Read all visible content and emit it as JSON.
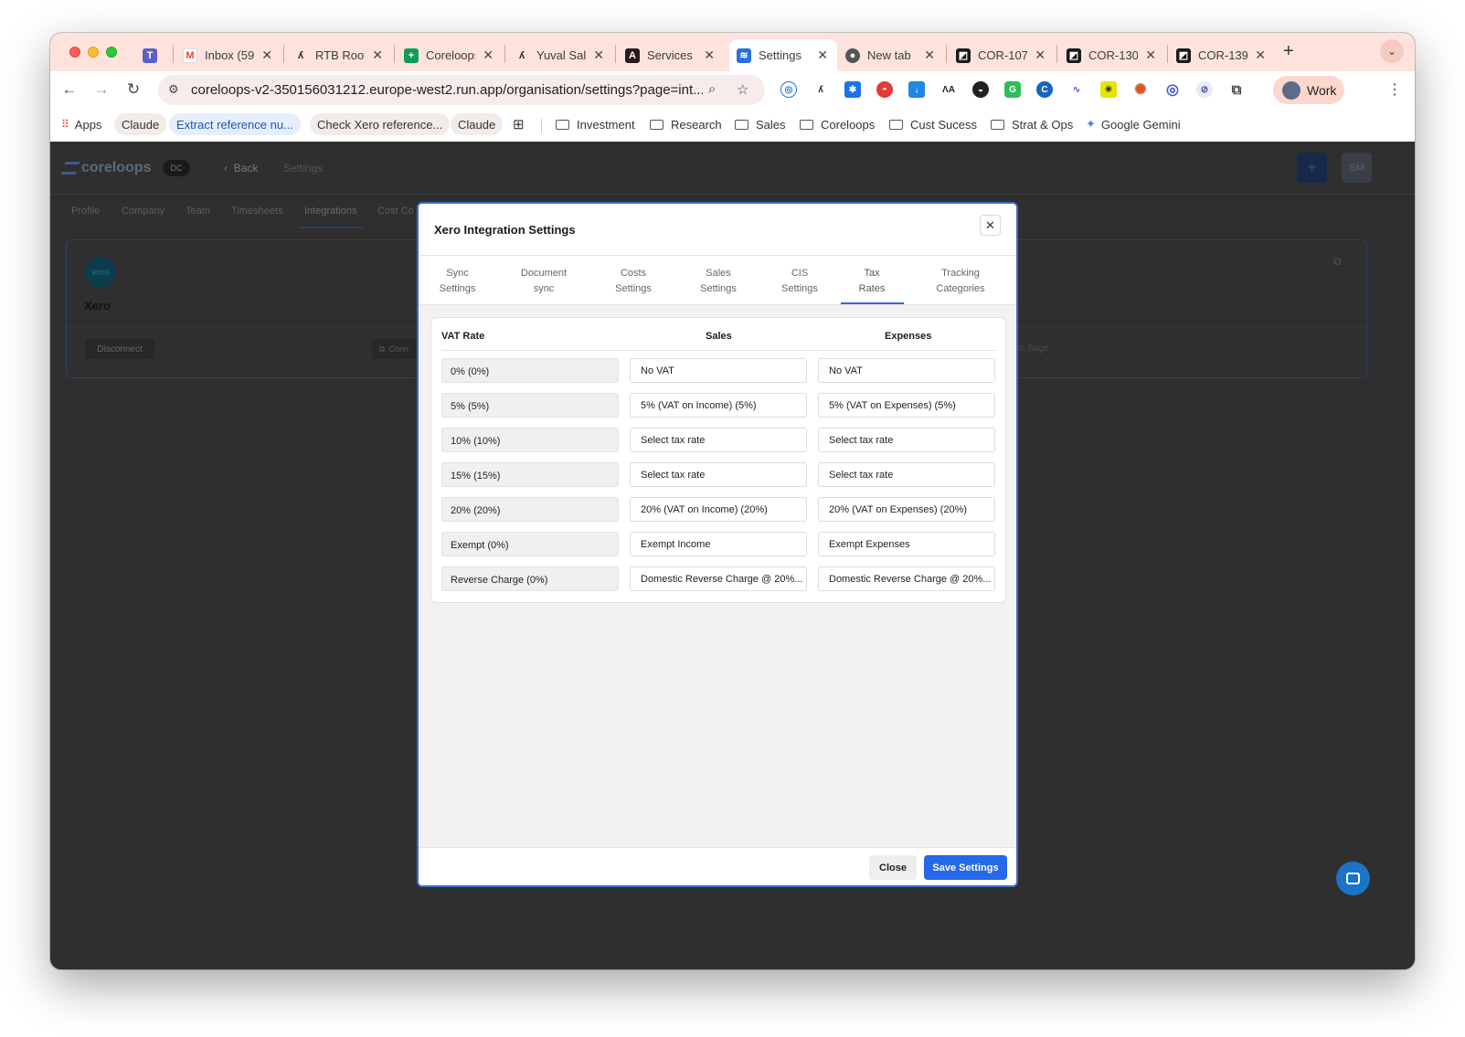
{
  "browser": {
    "tabs": [
      {
        "label": "",
        "icon": "teams-icon",
        "color": "#5b5fc7"
      },
      {
        "label": "Inbox (59",
        "icon": "gmail-icon",
        "color": "#ea4335"
      },
      {
        "label": "RTB Roof",
        "icon": "rtb-icon",
        "color": "#222222"
      },
      {
        "label": "Coreloops",
        "icon": "sheets-icon",
        "color": "#0f9d58"
      },
      {
        "label": "Yuval Sal",
        "icon": "rtb-icon",
        "color": "#222222"
      },
      {
        "label": "Services",
        "icon": "anthropic-icon",
        "color": "#2a1a1a"
      },
      {
        "label": "Settings",
        "icon": "coreloops-icon",
        "color": "#2b6fd6"
      },
      {
        "label": "New tab",
        "icon": "chrome-icon",
        "color": "#555555"
      },
      {
        "label": "COR-107",
        "icon": "linear-icon",
        "color": "#1a1a1a"
      },
      {
        "label": "COR-130",
        "icon": "linear-icon",
        "color": "#1a1a1a"
      },
      {
        "label": "COR-139",
        "icon": "linear-icon",
        "color": "#1a1a1a"
      }
    ],
    "url": "coreloops-v2-350156031212.europe-west2.run.app/organisation/settings?page=int...",
    "profile_label": "Work",
    "bookmarks": [
      {
        "label": "Apps",
        "kind": "apps"
      },
      {
        "label": "Claude",
        "kind": "chip"
      },
      {
        "label": "Extract reference nu...",
        "kind": "chip-blue"
      },
      {
        "label": "Check Xero reference...",
        "kind": "chip"
      },
      {
        "label": "Claude",
        "kind": "chip"
      },
      {
        "label": "Investment",
        "kind": "folder"
      },
      {
        "label": "Research",
        "kind": "folder"
      },
      {
        "label": "Sales",
        "kind": "folder"
      },
      {
        "label": "Coreloops",
        "kind": "folder"
      },
      {
        "label": "Cust Sucess",
        "kind": "folder"
      },
      {
        "label": "Strat & Ops",
        "kind": "folder"
      },
      {
        "label": "Google Gemini",
        "kind": "gemini"
      }
    ]
  },
  "app": {
    "logo_text": "coreloops",
    "org_badge": "DC",
    "back_label": "Back",
    "breadcrumb": "Settings",
    "avatar_initials": "SM",
    "tabs": [
      "Profile",
      "Company",
      "Team",
      "Timesheets",
      "Integrations",
      "Cost Co"
    ],
    "xero_card": {
      "logo_text": "xero",
      "name": "Xero",
      "disconnect_label": "Disconnect",
      "connect_label": "Conn",
      "sage_text": "to Sage"
    }
  },
  "modal": {
    "title": "Xero Integration Settings",
    "tabs": [
      {
        "line1": "Sync",
        "line2": "Settings"
      },
      {
        "line1": "Document",
        "line2": "sync"
      },
      {
        "line1": "Costs",
        "line2": "Settings"
      },
      {
        "line1": "Sales",
        "line2": "Settings"
      },
      {
        "line1": "CIS",
        "line2": "Settings"
      },
      {
        "line1": "Tax",
        "line2": "Rates"
      },
      {
        "line1": "Tracking",
        "line2": "Categories"
      }
    ],
    "active_tab": "Tax Rates",
    "table": {
      "headers": {
        "rate": "VAT Rate",
        "sales": "Sales",
        "expenses": "Expenses"
      },
      "rows": [
        {
          "rate": "0% (0%)",
          "sales": "No VAT",
          "expenses": "No VAT"
        },
        {
          "rate": "5% (5%)",
          "sales": "5% (VAT on Income) (5%)",
          "expenses": "5% (VAT on Expenses) (5%)"
        },
        {
          "rate": "10% (10%)",
          "sales": "Select tax rate",
          "expenses": "Select tax rate"
        },
        {
          "rate": "15% (15%)",
          "sales": "Select tax rate",
          "expenses": "Select tax rate"
        },
        {
          "rate": "20% (20%)",
          "sales": "20% (VAT on Income) (20%)",
          "expenses": "20% (VAT on Expenses) (20%)"
        },
        {
          "rate": "Exempt (0%)",
          "sales": "Exempt Income",
          "expenses": "Exempt Expenses"
        },
        {
          "rate": "Reverse Charge (0%)",
          "sales": "Domestic Reverse Charge @ 20%...",
          "expenses": "Domestic Reverse Charge @ 20%..."
        }
      ]
    },
    "close_label": "Close",
    "save_label": "Save Settings"
  },
  "colors": {
    "accent": "#2569e8",
    "tab_strip": "#fde3dc",
    "overlay": "#303030"
  }
}
